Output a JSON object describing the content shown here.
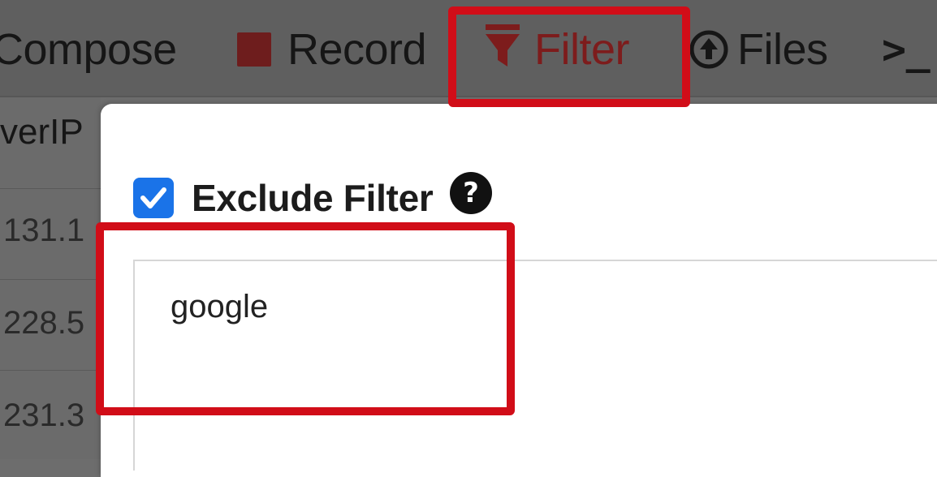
{
  "toolbar": {
    "compose_label": "Compose",
    "record_label": "Record",
    "filter_label": "Filter",
    "files_label": "Files",
    "console_label": ">_"
  },
  "table": {
    "header": "verIP",
    "rows": [
      "131.1",
      "228.5",
      "231.3"
    ]
  },
  "filter_panel": {
    "exclude_label": "Exclude Filter",
    "exclude_checked": true,
    "input_value": "google"
  },
  "colors": {
    "highlight": "#d10d18",
    "checkbox": "#1a73e8",
    "filter_active": "#7d1c1c"
  }
}
